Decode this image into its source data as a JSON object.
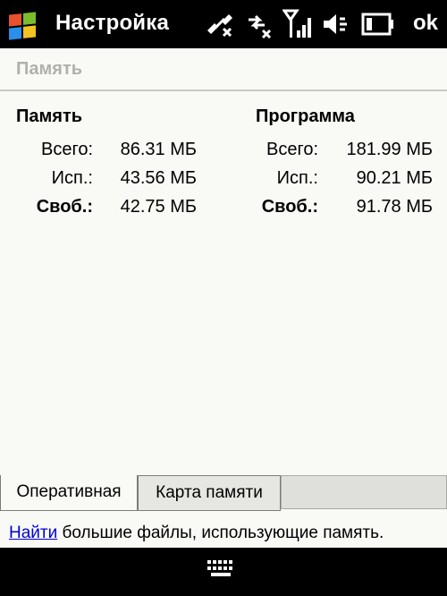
{
  "titlebar": {
    "title": "Настройка",
    "ok_label": "ok",
    "icons": [
      "windows-start-icon",
      "connectivity-icon",
      "data-connection-icon",
      "signal-icon",
      "volume-icon",
      "battery-icon"
    ]
  },
  "section": {
    "title": "Память"
  },
  "memory": {
    "title": "Память",
    "rows": [
      {
        "label": "Всего:",
        "value": "86.31 МБ"
      },
      {
        "label": "Исп.:",
        "value": "43.56 МБ"
      },
      {
        "label": "Своб.:",
        "value": "42.75 МБ"
      }
    ]
  },
  "program": {
    "title": "Программа",
    "rows": [
      {
        "label": "Всего:",
        "value": "181.99 МБ"
      },
      {
        "label": "Исп.:",
        "value": "90.21 МБ"
      },
      {
        "label": "Своб.:",
        "value": "91.78 МБ"
      }
    ]
  },
  "tabs": [
    {
      "label": "Оперативная",
      "active": true
    },
    {
      "label": "Карта памяти",
      "active": false
    }
  ],
  "hint": {
    "link": "Найти",
    "text": " большие файлы, использующие память."
  },
  "colors": {
    "bar": "#000000",
    "background": "#f9faf6",
    "link": "#0000d8",
    "section_title": "#b0b0ac"
  }
}
